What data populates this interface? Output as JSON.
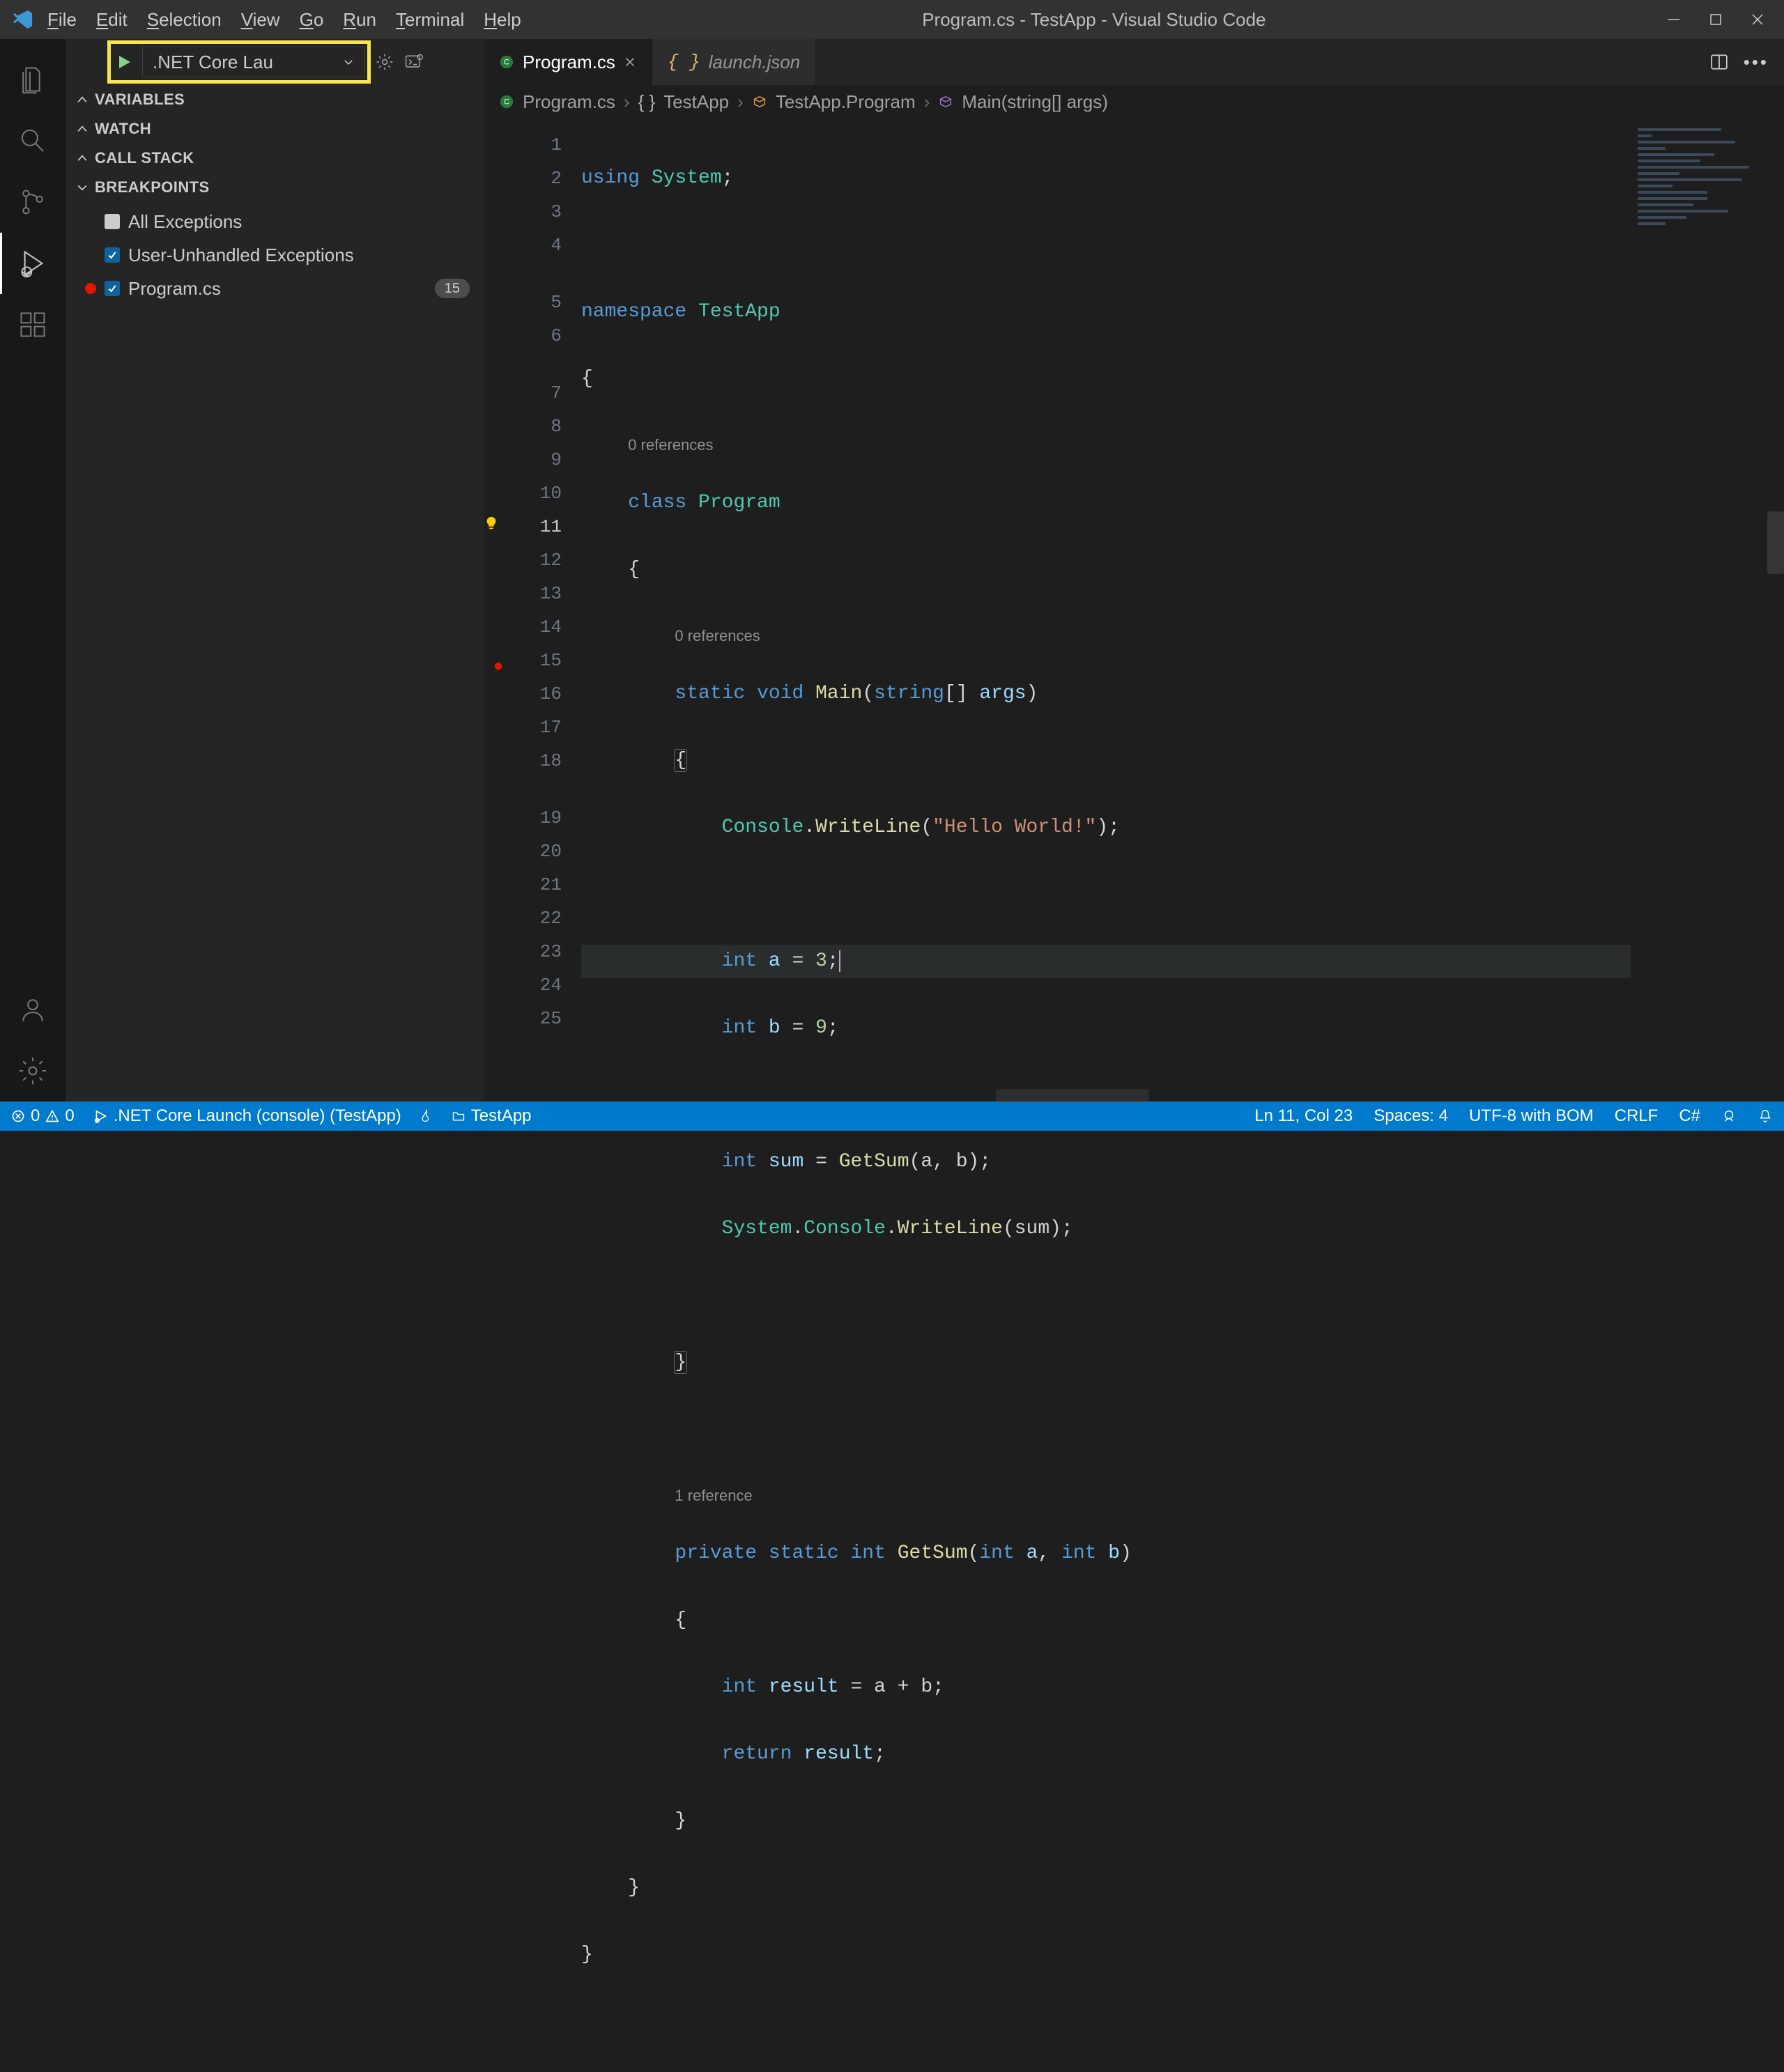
{
  "app": {
    "title": "Program.cs - TestApp - Visual Studio Code"
  },
  "menu": {
    "file": "File",
    "edit": "Edit",
    "selection": "Selection",
    "view": "View",
    "go": "Go",
    "run": "Run",
    "terminal": "Terminal",
    "help": "Help"
  },
  "debug": {
    "launch_config": ".NET Core Lau",
    "sections": {
      "variables": "VARIABLES",
      "watch": "WATCH",
      "callstack": "CALL STACK",
      "breakpoints": "BREAKPOINTS"
    },
    "breakpoints": {
      "all_exceptions": "All Exceptions",
      "user_unhandled": "User-Unhandled Exceptions",
      "file_bp": "Program.cs",
      "file_bp_line": "15"
    }
  },
  "tabs": {
    "active": "Program.cs",
    "inactive": "launch.json"
  },
  "breadcrumb": {
    "b0": "Program.cs",
    "b1": "TestApp",
    "b2": "TestApp.Program",
    "b3": "Main(string[] args)"
  },
  "code": {
    "lines": [
      "1",
      "2",
      "3",
      "4",
      "5",
      "6",
      "7",
      "8",
      "9",
      "10",
      "11",
      "12",
      "13",
      "14",
      "15",
      "16",
      "17",
      "18",
      "19",
      "20",
      "21",
      "22",
      "23",
      "24",
      "25"
    ],
    "ref0": "0 references",
    "ref1": "0 references",
    "ref2": "1 reference",
    "l1_using": "using",
    "l1_sys": "System",
    "l1_sc": ";",
    "l3_ns": "namespace",
    "l3_app": "TestApp",
    "brace_open": "{",
    "brace_close": "}",
    "l6_class": "class",
    "l6_prog": "Program",
    "l7_static": "static",
    "l7_void": "void",
    "l7_main": "Main",
    "l7_sig": "(",
    "l7_string": "string",
    "l7_brk": "[]",
    "l7_args": "args",
    "l7_close": ")",
    "l9_console": "Console",
    "l9_dot": ".",
    "l9_wl": "WriteLine",
    "l9_p1": "(",
    "l9_str": "\"Hello World!\"",
    "l9_p2": ");",
    "l11_int": "int",
    "l11_a": "a",
    "l11_eq": " = ",
    "l11_3": "3",
    "l11_sc": ";",
    "l12_int": "int",
    "l12_b": "b",
    "l12_eq": " = ",
    "l12_9": "9",
    "l12_sc": ";",
    "l14_int": "int",
    "l14_sum": "sum",
    "l14_eq": " = ",
    "l14_get": "GetSum",
    "l14_args": "(a, b);",
    "l15_sys": "System",
    "l15_d": ".",
    "l15_con": "Console",
    "l15_d2": ".",
    "l15_wl": "WriteLine",
    "l15_args": "(sum);",
    "l19_priv": "private",
    "l19_static": "static",
    "l19_int": "int",
    "l19_get": "GetSum",
    "l19_p1": "(",
    "l19_int2": "int",
    "l19_a": "a",
    "l19_c": ", ",
    "l19_int3": "int",
    "l19_b": "b",
    "l19_p2": ")",
    "l21_int": "int",
    "l21_res": "result",
    "l21_eq": " = a + b;",
    "l22_ret": "return",
    "l22_res": "result",
    "l22_sc": ";"
  },
  "status": {
    "errors": "0",
    "warnings": "0",
    "launch_name": ".NET Core Launch (console) (TestApp)",
    "folder": "TestApp",
    "ln_col": "Ln 11, Col 23",
    "spaces": "Spaces: 4",
    "encoding": "UTF-8 with BOM",
    "eol": "CRLF",
    "lang": "C#"
  }
}
